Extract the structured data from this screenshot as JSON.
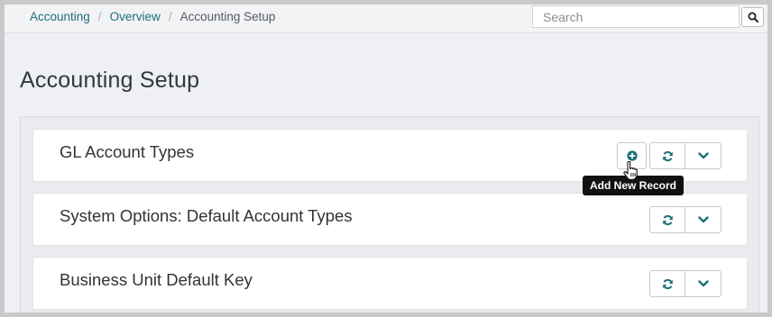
{
  "breadcrumb": {
    "items": [
      "Accounting",
      "Overview"
    ],
    "separator": "/",
    "current": "Accounting Setup"
  },
  "search": {
    "placeholder": "Search",
    "value": "",
    "icon": "search-icon"
  },
  "page": {
    "title": "Accounting Setup"
  },
  "cards": [
    {
      "title": "GL Account Types",
      "has_add": true
    },
    {
      "title": "System Options: Default Account Types",
      "has_add": false
    },
    {
      "title": "Business Unit Default Key",
      "has_add": false
    }
  ],
  "tooltip": {
    "text": "Add New Record"
  },
  "icons": {
    "add": "plus-circle-icon",
    "refresh": "refresh-icon",
    "caret": "chevron-down-icon",
    "cursor": "hand-pointer-icon"
  },
  "colors": {
    "accent": "#1f6f78",
    "tooltip_bg": "#111111"
  }
}
